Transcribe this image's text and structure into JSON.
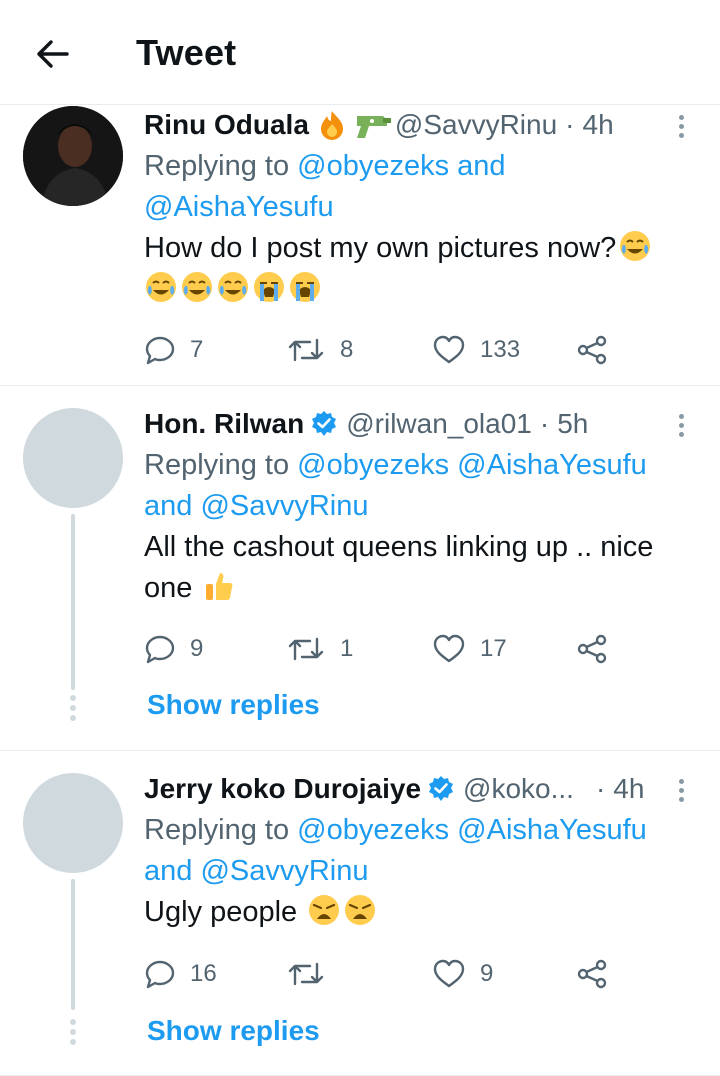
{
  "header": {
    "title": "Tweet"
  },
  "tweets": [
    {
      "name": "Rinu Oduala",
      "handle": "@SavvyRinu",
      "time": "4h",
      "replying_prefix": "Replying to",
      "replying_handles": [
        "@obyezeks",
        "@AishaYesufu"
      ],
      "replying_joiner": "and",
      "text": "How do I post my own pictures now?",
      "replies": "7",
      "retweets": "8",
      "likes": "133"
    },
    {
      "name": "Hon. Rilwan",
      "handle": "@rilwan_ola01",
      "time": "5h",
      "replying_prefix": "Replying to",
      "replying_handles": [
        "@obyezeks",
        "@AishaYesufu",
        "@SavvyRinu"
      ],
      "replying_joiner": "and",
      "text": "All the cashout queens linking up .. nice one",
      "replies": "9",
      "retweets": "1",
      "likes": "17",
      "show_replies": "Show replies"
    },
    {
      "name": "Jerry koko Durojaiye",
      "handle": "@koko...",
      "time": "4h",
      "replying_prefix": "Replying to",
      "replying_handles": [
        "@obyezeks",
        "@AishaYesufu",
        "@SavvyRinu"
      ],
      "replying_joiner": "and",
      "text": "Ugly people",
      "replies": "16",
      "retweets": "",
      "likes": "9",
      "show_replies": "Show replies"
    }
  ],
  "sep": "·",
  "colors": {
    "link": "#1d9bf0",
    "muted": "#536471",
    "verified": "#1d9bf0",
    "avatar_placeholder": "#cfd9de"
  }
}
